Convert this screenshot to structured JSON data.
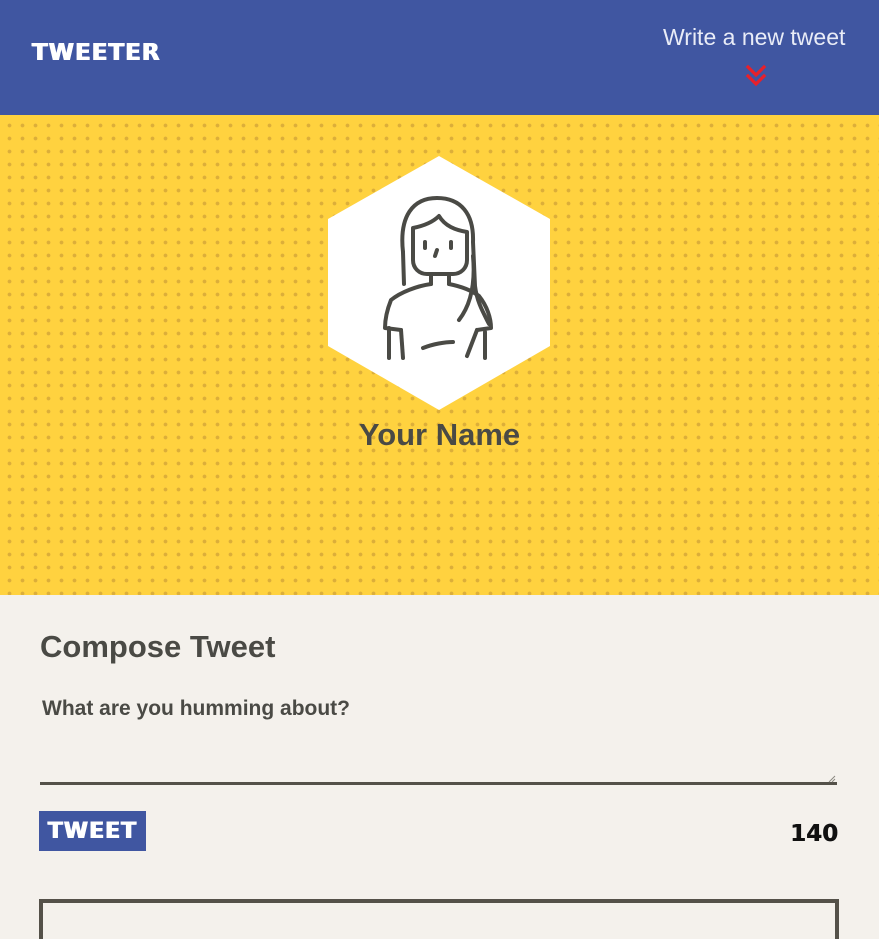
{
  "nav": {
    "logo": "TWEETER",
    "compose_link": "Write a new tweet",
    "chevron_color": "#e8202a"
  },
  "profile": {
    "name": "Your Name",
    "avatar_icon": "user-avatar-icon"
  },
  "compose": {
    "title": "Compose Tweet",
    "input_value": "",
    "input_placeholder": "What are you humming about?",
    "button_label": "TWEET",
    "counter": "140"
  },
  "colors": {
    "nav_bg": "#4056a1",
    "hero_bg": "#ffd23f",
    "page_bg": "#f4f1ec",
    "text": "#4a4a45"
  }
}
